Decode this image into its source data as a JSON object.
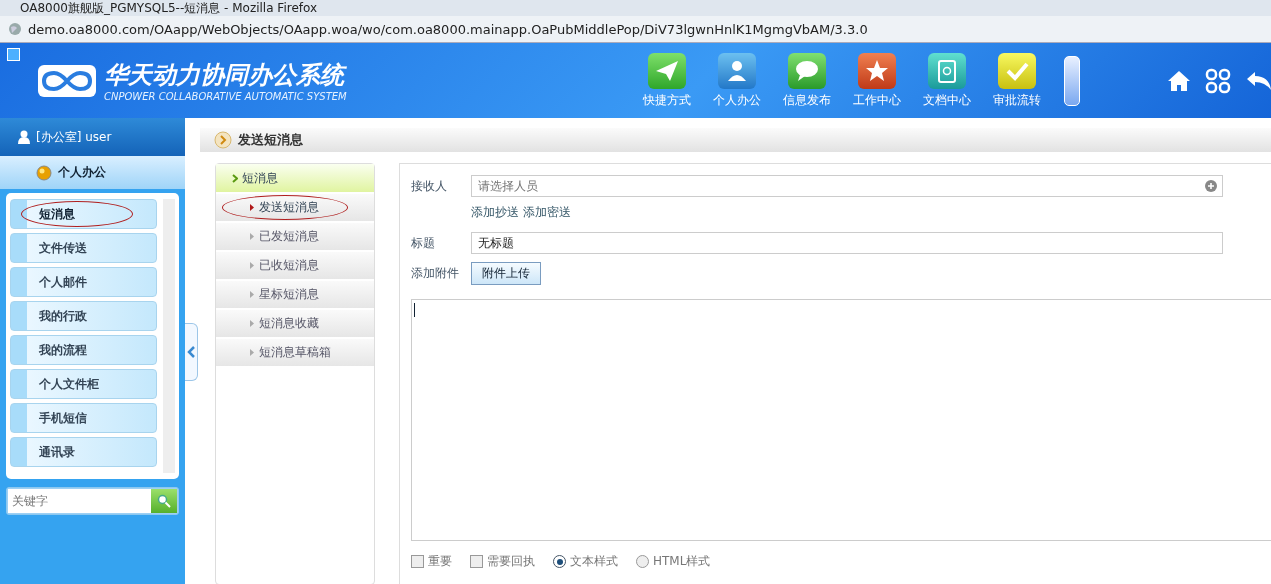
{
  "window": {
    "title": "OA8000旗舰版_PGMYSQL5--短消息 - Mozilla Firefox"
  },
  "address_bar": {
    "url": "demo.oa8000.com/OAapp/WebObjects/OAapp.woa/wo/com.oa8000.mainapp.OaPubMiddlePop/DiV73lgwnHnlK1MgmgVbAM/3.3.0"
  },
  "header": {
    "logo_title": "华天动力协同办公系统",
    "logo_subtitle": "CNPOWER COLLABORATIVE AUTOMATIC SYSTEM",
    "nav": [
      {
        "label": "快捷方式",
        "kind": "send"
      },
      {
        "label": "个人办公",
        "kind": "person"
      },
      {
        "label": "信息发布",
        "kind": "chat"
      },
      {
        "label": "工作中心",
        "kind": "star"
      },
      {
        "label": "文档中心",
        "kind": "contacts"
      },
      {
        "label": "审批流转",
        "kind": "check"
      }
    ]
  },
  "sidebar": {
    "user": "[办公室] user",
    "section": "个人办公",
    "items": [
      {
        "label": "短消息",
        "selected": true
      },
      {
        "label": "文件传送",
        "selected": false
      },
      {
        "label": "个人邮件",
        "selected": false
      },
      {
        "label": "我的行政",
        "selected": false
      },
      {
        "label": "我的流程",
        "selected": false
      },
      {
        "label": "个人文件柜",
        "selected": false
      },
      {
        "label": "手机短信",
        "selected": false
      },
      {
        "label": "通讯录",
        "selected": false
      }
    ],
    "search": {
      "placeholder": "关键字"
    }
  },
  "page": {
    "title": "发送短消息"
  },
  "subnav": {
    "header": "短消息",
    "items": [
      {
        "label": "发送短消息",
        "selected": true
      },
      {
        "label": "已发短消息",
        "selected": false
      },
      {
        "label": "已收短消息",
        "selected": false
      },
      {
        "label": "星标短消息",
        "selected": false
      },
      {
        "label": "短消息收藏",
        "selected": false
      },
      {
        "label": "短消息草稿箱",
        "selected": false
      }
    ]
  },
  "form": {
    "recipient_label": "接收人",
    "recipient_placeholder": "请选择人员",
    "add_cc": "添加抄送",
    "add_bcc": "添加密送",
    "subject_label": "标题",
    "subject_value": "无标题",
    "attachment_label": "添加附件",
    "upload_button": "附件上传",
    "options": [
      {
        "label": "重要",
        "kind": "checkbox",
        "checked": false
      },
      {
        "label": "需要回执",
        "kind": "checkbox",
        "checked": false
      },
      {
        "label": "文本样式",
        "kind": "radio",
        "selected": true
      },
      {
        "label": "HTML样式",
        "kind": "radio",
        "selected": false
      }
    ]
  }
}
